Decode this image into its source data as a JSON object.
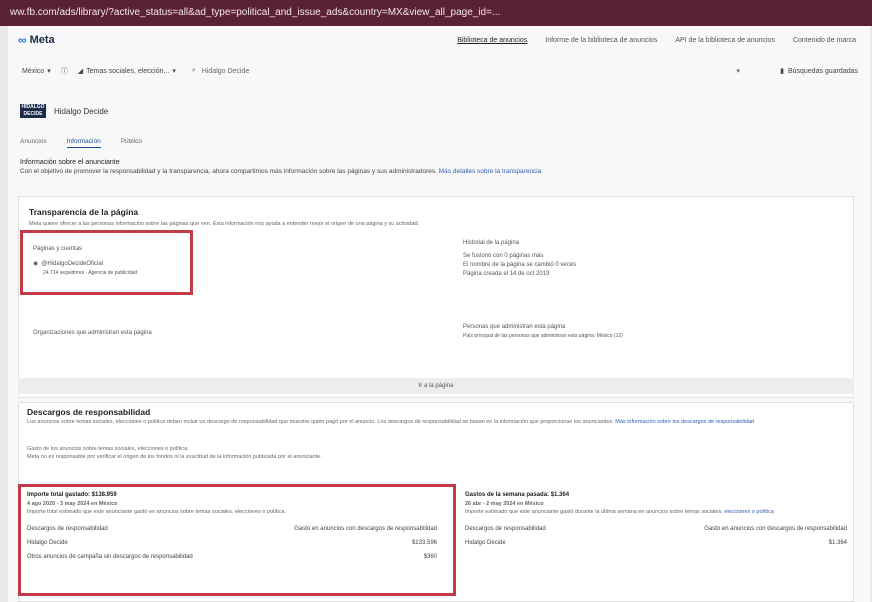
{
  "browser": {
    "url_text": "ww.fb.com/ads/library/?active_status=all&ad_type=political_and_issue_ads&country=MX&view_all_page_id=..."
  },
  "header": {
    "logo_text": "Meta",
    "links": [
      "Biblioteca de anuncios",
      "Informe de la biblioteca de anuncios",
      "API de la biblioteca de anuncios",
      "Contenido de marca"
    ]
  },
  "filters": {
    "country": "México",
    "category": "Temas sociales, elección...",
    "search_value": "Hidalgo Decide",
    "saved_searches": "Búsquedas guardadas"
  },
  "advertiser": {
    "logo_text": "HIDALGO DECIDE",
    "name": "Hidalgo Decide"
  },
  "tabs": [
    "Anuncios",
    "Información",
    "Público"
  ],
  "info": {
    "heading": "Información sobre el anunciante",
    "text": "Con el objetivo de promover la responsabilidad y la transparencia, ahora compartimos más información sobre las páginas y sus administradores.",
    "link": "Más detalles sobre la transparencia"
  },
  "transparency": {
    "title": "Transparencia de la página",
    "text": "Meta quiere ofrecer a las personas información sobre las páginas que ven. Esta información nos ayuda a entender mejor el origen de una página y su actividad.",
    "pages_label": "Páginas y cuentas",
    "page_handle": "@HidalgoDecideOficial",
    "page_stats": "24.714 seguidores · Agencia de publicidad",
    "history_label": "Historial de la página",
    "history_items": [
      "Se fusionó con 0 páginas más",
      "El nombre de la página se cambió 0 veces",
      "Página creada el 14 de oct 2019"
    ],
    "orgs_label": "Organizaciones que administran esta página",
    "people_label": "Personas que administran esta página",
    "people_text": "País principal de las personas que administran esta página: México (12)",
    "view_page": "Ir a la página"
  },
  "disclaimer": {
    "title": "Descargos de responsabilidad",
    "text": "Los anuncios sobre temas sociales, elecciones o política deben incluir un descargo de responsabilidad que muestre quién pagó por el anuncio. Los descargos de responsabilidad se basan en la información que proporcionan los anunciantes.",
    "link": "Más información sobre los descargos de responsabilidad",
    "note_lines": [
      "Gasto de los anuncios sobre temas sociales, elecciones o política.",
      "Meta no es responsable por verificar el origen de los fondos ni la exactitud de la información publicada por el anunciante."
    ],
    "total": {
      "title": "Importe total gastado: $138.959",
      "dates": "4 ago 2020 - 3 may 2024 en México",
      "text": "Importe total estimado que este anunciante gastó en anuncios sobre temas sociales, elecciones o política.",
      "col1": "Descargos de responsabilidad",
      "col2": "Gasto en anuncios con descargos de responsabilidad",
      "row_name": "Hidalgo Decide",
      "row_value": "$133.596",
      "other_label": "Otros anuncios de campaña sin descargos de responsabilidad",
      "other_value": "$360"
    },
    "week": {
      "title": "Gastos de la semana pasada: $1.364",
      "dates": "26 abr - 2 may 2024 en México",
      "text": "Importe estimado que este anunciante gastó durante la última semana en anuncios sobre temas sociales.",
      "link": "elecciones o política",
      "col1": "Descargos de responsabilidad",
      "col2": "Gasto en anuncios con descargos de responsabilidad",
      "row_name": "Hidalgo Decide",
      "row_value": "$1.364"
    }
  },
  "colors": {
    "highlight": "#c23a47",
    "link": "#2b5fb3",
    "url_bar": "#5a2232"
  }
}
